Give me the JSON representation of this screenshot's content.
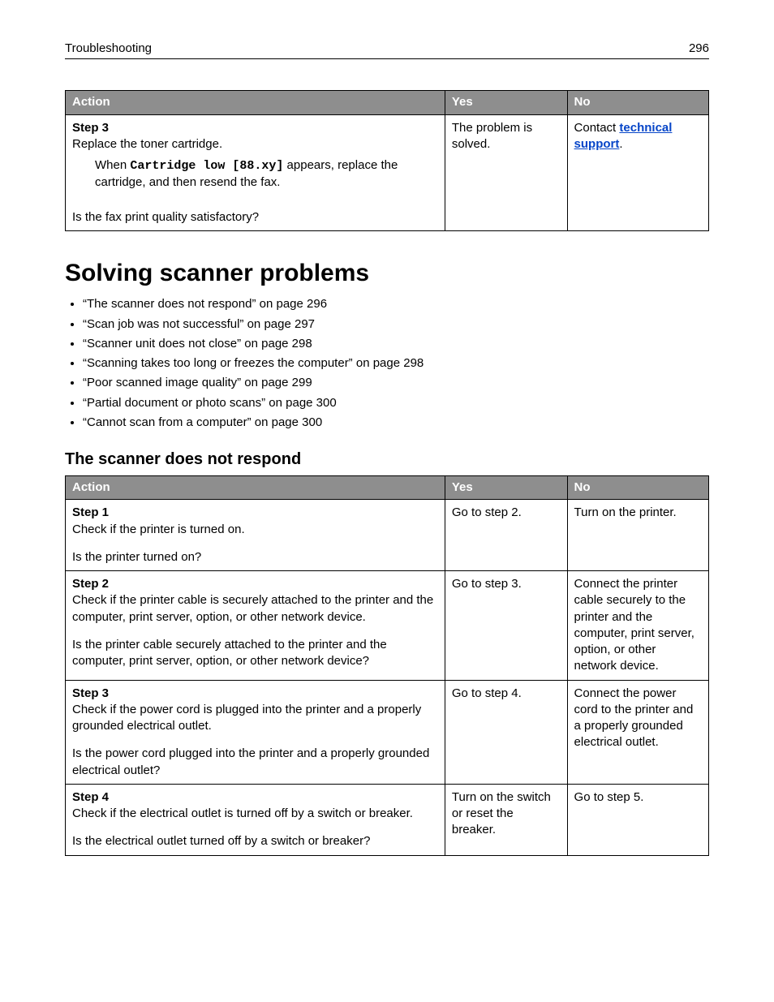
{
  "header": {
    "title": "Troubleshooting",
    "page": "296"
  },
  "table1": {
    "cols": {
      "action": "Action",
      "yes": "Yes",
      "no": "No"
    },
    "row": {
      "step": "Step 3",
      "line1": "Replace the toner cartridge.",
      "sub_pre": "When ",
      "sub_code": "Cartridge low [88.xy]",
      "sub_post": " appears, replace the cartridge, and then resend the fax.",
      "question": "Is the fax print quality satisfactory?",
      "yes": "The problem is solved.",
      "no_pre": "Contact ",
      "no_link": "technical support",
      "no_post": "."
    }
  },
  "section_title": "Solving scanner problems",
  "toc": [
    "“The scanner does not respond” on page 296",
    "“Scan job was not successful” on page 297",
    "“Scanner unit does not close” on page 298",
    "“Scanning takes too long or freezes the computer” on page 298",
    "“Poor scanned image quality” on page 299",
    "“Partial document or photo scans” on page 300",
    "“Cannot scan from a computer” on page 300"
  ],
  "subsection_title": "The scanner does not respond",
  "table2": {
    "cols": {
      "action": "Action",
      "yes": "Yes",
      "no": "No"
    },
    "rows": [
      {
        "step": "Step 1",
        "line1": "Check if the printer is turned on.",
        "question": "Is the printer turned on?",
        "yes": "Go to step 2.",
        "no": "Turn on the printer."
      },
      {
        "step": "Step 2",
        "line1": "Check if the printer cable is securely attached to the printer and the computer, print server, option, or other network device.",
        "question": "Is the printer cable securely attached to the printer and the computer, print server, option, or other network device?",
        "yes": "Go to step 3.",
        "no": "Connect the printer cable securely to the printer and the computer, print server, option, or other network device."
      },
      {
        "step": "Step 3",
        "line1": "Check if the power cord is plugged into the printer and a properly grounded electrical outlet.",
        "question": "Is the power cord plugged into the printer and a properly grounded electrical outlet?",
        "yes": "Go to step 4.",
        "no": "Connect the power cord to the printer and a properly grounded electrical outlet."
      },
      {
        "step": "Step 4",
        "line1": "Check if the electrical outlet is turned off by a switch or breaker.",
        "question": "Is the electrical outlet turned off by a switch or breaker?",
        "yes": "Turn on the switch or reset the breaker.",
        "no": "Go to step 5."
      }
    ]
  }
}
